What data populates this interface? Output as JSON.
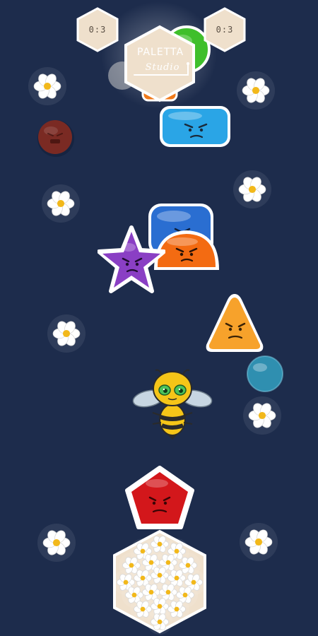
{
  "hud": {
    "left_counter": "0:3",
    "right_counter": "0:3"
  },
  "logo": {
    "line1": "PALETTA",
    "line2": "Studio"
  },
  "pieces": [
    {
      "name": "blue-rounded-rect-face",
      "shape": "rounded-rect",
      "color": "#2aa5e6",
      "mood": "angry"
    },
    {
      "name": "dark-red-ball",
      "shape": "circle",
      "color": "#7a2a23",
      "mood": "angry"
    },
    {
      "name": "blue-square-face",
      "shape": "rounded-rect",
      "color": "#2a6ed1",
      "mood": "angry"
    },
    {
      "name": "orange-dome-face",
      "shape": "dome",
      "color": "#f36b12",
      "mood": "angry"
    },
    {
      "name": "purple-star-face",
      "shape": "star",
      "color": "#8a3fc4",
      "mood": "angry"
    },
    {
      "name": "yellow-triangle-face",
      "shape": "triangle",
      "color": "#f7a22b",
      "mood": "angry"
    },
    {
      "name": "teal-ball",
      "shape": "circle",
      "color": "#2f8fb0",
      "mood": "none"
    },
    {
      "name": "red-pentagon-face",
      "shape": "pentagon",
      "color": "#d3171b",
      "mood": "angry"
    },
    {
      "name": "green-circle",
      "shape": "circle",
      "color": "#3fbf2b",
      "mood": "none"
    },
    {
      "name": "orange-behind-logo",
      "shape": "circle",
      "color": "#f07a1a",
      "mood": "none"
    }
  ],
  "player": {
    "name": "bee-character",
    "icon": "bee-icon"
  },
  "goal": {
    "name": "flower-hive",
    "icon": "hexagon-hive-icon"
  },
  "decor": {
    "icon": "daisy-icon"
  },
  "colors": {
    "background": "#1d2c4c",
    "badge_fill": "#efe0cc",
    "badge_text": "#5b5045",
    "daisy_petal": "#ffffff",
    "daisy_center": "#f2b81a"
  }
}
